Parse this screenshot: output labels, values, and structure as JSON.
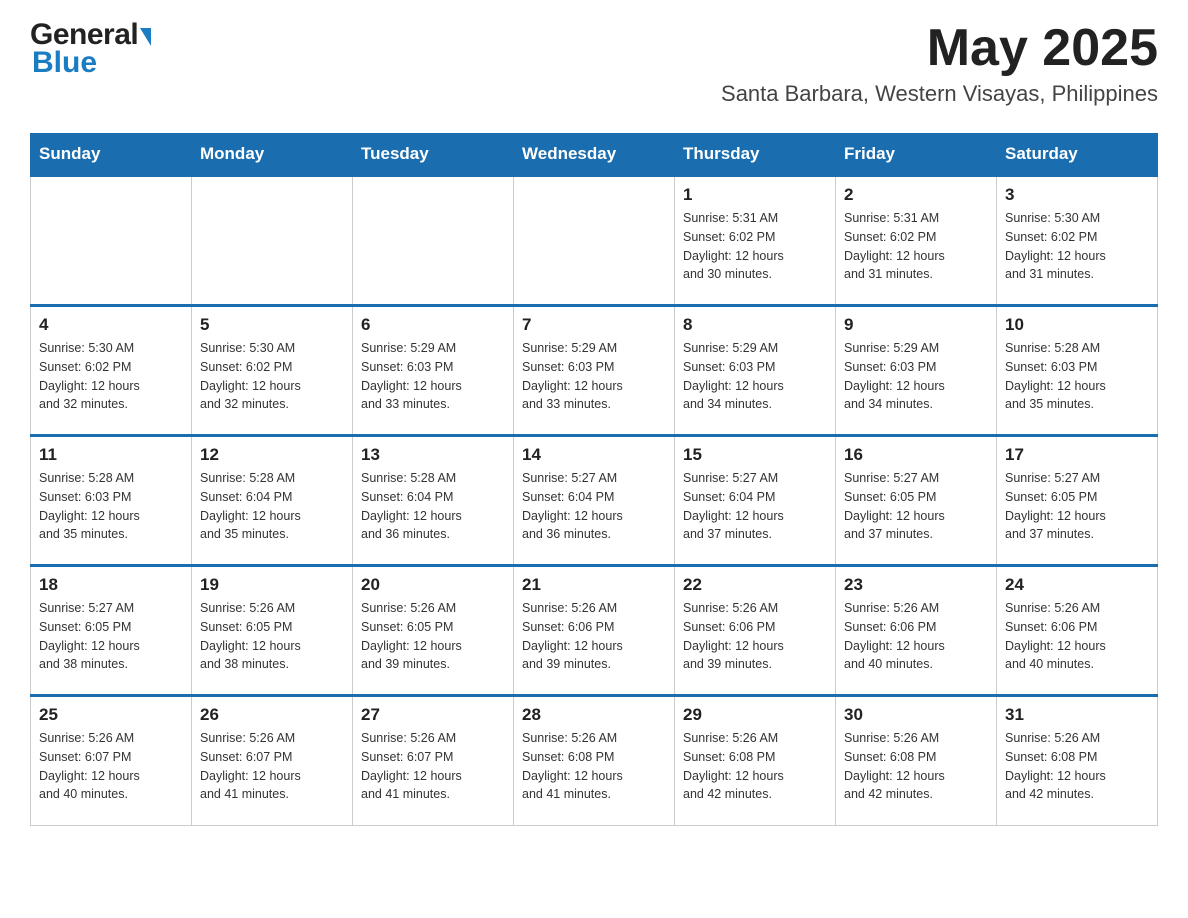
{
  "header": {
    "logo_general": "General",
    "logo_blue": "Blue",
    "month_year": "May 2025",
    "location": "Santa Barbara, Western Visayas, Philippines"
  },
  "calendar": {
    "days_of_week": [
      "Sunday",
      "Monday",
      "Tuesday",
      "Wednesday",
      "Thursday",
      "Friday",
      "Saturday"
    ],
    "weeks": [
      [
        {
          "day": "",
          "info": ""
        },
        {
          "day": "",
          "info": ""
        },
        {
          "day": "",
          "info": ""
        },
        {
          "day": "",
          "info": ""
        },
        {
          "day": "1",
          "info": "Sunrise: 5:31 AM\nSunset: 6:02 PM\nDaylight: 12 hours\nand 30 minutes."
        },
        {
          "day": "2",
          "info": "Sunrise: 5:31 AM\nSunset: 6:02 PM\nDaylight: 12 hours\nand 31 minutes."
        },
        {
          "day": "3",
          "info": "Sunrise: 5:30 AM\nSunset: 6:02 PM\nDaylight: 12 hours\nand 31 minutes."
        }
      ],
      [
        {
          "day": "4",
          "info": "Sunrise: 5:30 AM\nSunset: 6:02 PM\nDaylight: 12 hours\nand 32 minutes."
        },
        {
          "day": "5",
          "info": "Sunrise: 5:30 AM\nSunset: 6:02 PM\nDaylight: 12 hours\nand 32 minutes."
        },
        {
          "day": "6",
          "info": "Sunrise: 5:29 AM\nSunset: 6:03 PM\nDaylight: 12 hours\nand 33 minutes."
        },
        {
          "day": "7",
          "info": "Sunrise: 5:29 AM\nSunset: 6:03 PM\nDaylight: 12 hours\nand 33 minutes."
        },
        {
          "day": "8",
          "info": "Sunrise: 5:29 AM\nSunset: 6:03 PM\nDaylight: 12 hours\nand 34 minutes."
        },
        {
          "day": "9",
          "info": "Sunrise: 5:29 AM\nSunset: 6:03 PM\nDaylight: 12 hours\nand 34 minutes."
        },
        {
          "day": "10",
          "info": "Sunrise: 5:28 AM\nSunset: 6:03 PM\nDaylight: 12 hours\nand 35 minutes."
        }
      ],
      [
        {
          "day": "11",
          "info": "Sunrise: 5:28 AM\nSunset: 6:03 PM\nDaylight: 12 hours\nand 35 minutes."
        },
        {
          "day": "12",
          "info": "Sunrise: 5:28 AM\nSunset: 6:04 PM\nDaylight: 12 hours\nand 35 minutes."
        },
        {
          "day": "13",
          "info": "Sunrise: 5:28 AM\nSunset: 6:04 PM\nDaylight: 12 hours\nand 36 minutes."
        },
        {
          "day": "14",
          "info": "Sunrise: 5:27 AM\nSunset: 6:04 PM\nDaylight: 12 hours\nand 36 minutes."
        },
        {
          "day": "15",
          "info": "Sunrise: 5:27 AM\nSunset: 6:04 PM\nDaylight: 12 hours\nand 37 minutes."
        },
        {
          "day": "16",
          "info": "Sunrise: 5:27 AM\nSunset: 6:05 PM\nDaylight: 12 hours\nand 37 minutes."
        },
        {
          "day": "17",
          "info": "Sunrise: 5:27 AM\nSunset: 6:05 PM\nDaylight: 12 hours\nand 37 minutes."
        }
      ],
      [
        {
          "day": "18",
          "info": "Sunrise: 5:27 AM\nSunset: 6:05 PM\nDaylight: 12 hours\nand 38 minutes."
        },
        {
          "day": "19",
          "info": "Sunrise: 5:26 AM\nSunset: 6:05 PM\nDaylight: 12 hours\nand 38 minutes."
        },
        {
          "day": "20",
          "info": "Sunrise: 5:26 AM\nSunset: 6:05 PM\nDaylight: 12 hours\nand 39 minutes."
        },
        {
          "day": "21",
          "info": "Sunrise: 5:26 AM\nSunset: 6:06 PM\nDaylight: 12 hours\nand 39 minutes."
        },
        {
          "day": "22",
          "info": "Sunrise: 5:26 AM\nSunset: 6:06 PM\nDaylight: 12 hours\nand 39 minutes."
        },
        {
          "day": "23",
          "info": "Sunrise: 5:26 AM\nSunset: 6:06 PM\nDaylight: 12 hours\nand 40 minutes."
        },
        {
          "day": "24",
          "info": "Sunrise: 5:26 AM\nSunset: 6:06 PM\nDaylight: 12 hours\nand 40 minutes."
        }
      ],
      [
        {
          "day": "25",
          "info": "Sunrise: 5:26 AM\nSunset: 6:07 PM\nDaylight: 12 hours\nand 40 minutes."
        },
        {
          "day": "26",
          "info": "Sunrise: 5:26 AM\nSunset: 6:07 PM\nDaylight: 12 hours\nand 41 minutes."
        },
        {
          "day": "27",
          "info": "Sunrise: 5:26 AM\nSunset: 6:07 PM\nDaylight: 12 hours\nand 41 minutes."
        },
        {
          "day": "28",
          "info": "Sunrise: 5:26 AM\nSunset: 6:08 PM\nDaylight: 12 hours\nand 41 minutes."
        },
        {
          "day": "29",
          "info": "Sunrise: 5:26 AM\nSunset: 6:08 PM\nDaylight: 12 hours\nand 42 minutes."
        },
        {
          "day": "30",
          "info": "Sunrise: 5:26 AM\nSunset: 6:08 PM\nDaylight: 12 hours\nand 42 minutes."
        },
        {
          "day": "31",
          "info": "Sunrise: 5:26 AM\nSunset: 6:08 PM\nDaylight: 12 hours\nand 42 minutes."
        }
      ]
    ]
  }
}
